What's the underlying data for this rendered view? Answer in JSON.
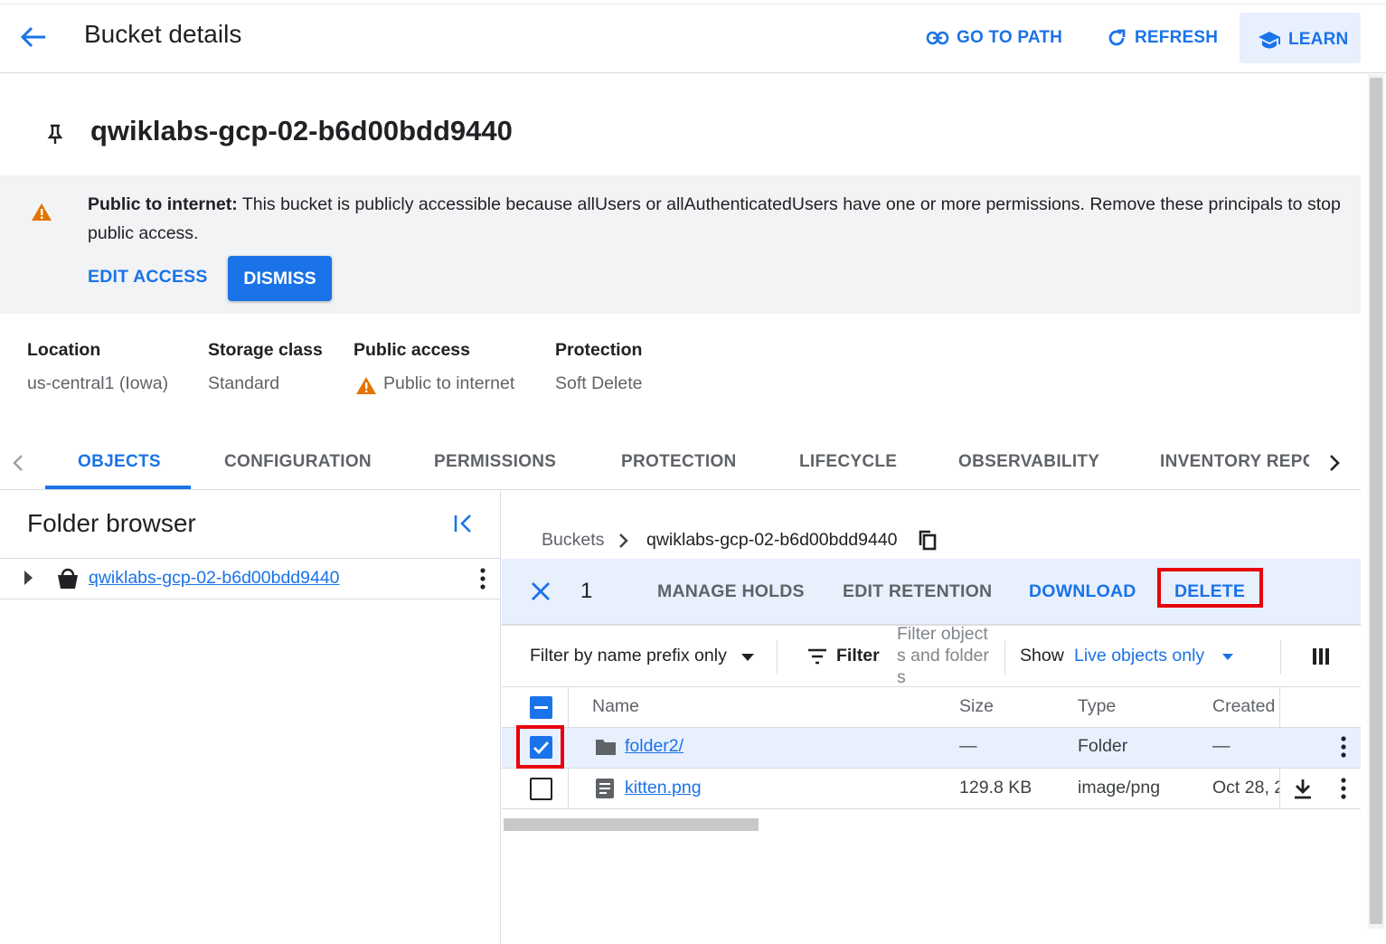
{
  "header": {
    "title": "Bucket details",
    "go_to_path": "GO TO PATH",
    "refresh": "REFRESH",
    "learn": "LEARN"
  },
  "bucket": {
    "name": "qwiklabs-gcp-02-b6d00bdd9440"
  },
  "banner": {
    "bold": "Public to internet:",
    "text": " This bucket is publicly accessible because allUsers or allAuthenticatedUsers have one or more permissions. Remove these principals to stop public access.",
    "edit_access": "EDIT ACCESS",
    "dismiss": "DISMISS"
  },
  "properties": [
    {
      "label": "Location",
      "value": "us-central1 (Iowa)"
    },
    {
      "label": "Storage class",
      "value": "Standard"
    },
    {
      "label": "Public access",
      "value": "Public to internet"
    },
    {
      "label": "Protection",
      "value": "Soft Delete"
    }
  ],
  "tabs": [
    {
      "label": "OBJECTS"
    },
    {
      "label": "CONFIGURATION"
    },
    {
      "label": "PERMISSIONS"
    },
    {
      "label": "PROTECTION"
    },
    {
      "label": "LIFECYCLE"
    },
    {
      "label": "OBSERVABILITY"
    },
    {
      "label": "INVENTORY REPO"
    }
  ],
  "folder_browser": {
    "title": "Folder browser",
    "root": "qwiklabs-gcp-02-b6d00bdd9440"
  },
  "breadcrumb": {
    "root": "Buckets",
    "current": "qwiklabs-gcp-02-b6d00bdd9440"
  },
  "action_bar": {
    "selected_count": "1",
    "manage_holds": "MANAGE HOLDS",
    "edit_retention": "EDIT RETENTION",
    "download": "DOWNLOAD",
    "delete": "DELETE"
  },
  "filter": {
    "prefix_mode": "Filter by name prefix only",
    "filter_label": "Filter",
    "placeholder_line1": "Filter object",
    "placeholder_line2": "s and folder",
    "placeholder_line3": "s",
    "show_label": "Show",
    "show_value": "Live objects only"
  },
  "table": {
    "headers": {
      "name": "Name",
      "size": "Size",
      "type": "Type",
      "created": "Created"
    },
    "rows": [
      {
        "name": "folder2/",
        "size": "—",
        "type": "Folder",
        "created": "—",
        "checked": true
      },
      {
        "name": "kitten.png",
        "size": "129.8 KB",
        "type": "image/png",
        "created": "Oct 28, 2",
        "checked": false
      }
    ]
  },
  "colors": {
    "accent": "#1a73e8",
    "warning": "#e37400",
    "highlight": "#e8000b"
  }
}
